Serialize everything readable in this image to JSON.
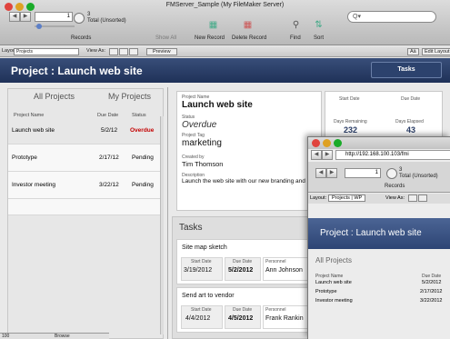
{
  "window": {
    "title": "FMServer_Sample (My FileMaker Server)"
  },
  "toolbar": {
    "record_number": "1",
    "record_count": "3",
    "found_status": "Total (Unsorted)",
    "records_label": "Records",
    "show_all": "Show All",
    "new_record": "New Record",
    "delete_record": "Delete Record",
    "find": "Find",
    "sort": "Sort",
    "search_placeholder": "Q▾"
  },
  "layout_bar": {
    "layout_label": "Layout:",
    "layout_value": "Projects",
    "view_as": "View As:",
    "preview": "Preview",
    "font_btn": "Aä",
    "edit_layout": "Edit Layout"
  },
  "header": {
    "title": "Project : Launch web site",
    "tasks_btn": "Tasks"
  },
  "left": {
    "tab_all": "All Projects",
    "tab_my": "My Projects",
    "col_name": "Project Name",
    "col_due": "Due Date",
    "col_status": "Status",
    "rows": [
      {
        "name": "Launch web site",
        "due": "5/2/12",
        "status": "Overdue"
      },
      {
        "name": "Prototype",
        "due": "2/17/12",
        "status": "Pending"
      },
      {
        "name": "Investor meeting",
        "due": "3/22/12",
        "status": "Pending"
      }
    ]
  },
  "detail": {
    "name_lbl": "Project Name",
    "name": "Launch web site",
    "status_lbl": "Status",
    "status": "Overdue",
    "tag_lbl": "Project Tag",
    "tag": "marketing",
    "created_lbl": "Created by",
    "created": "Tim Thomson",
    "desc_lbl": "Description",
    "desc": "Launch the web site with our new branding and",
    "start_lbl": "Start Date",
    "due_lbl": "Due Date",
    "remain_lbl": "Days Remaining",
    "remain": "232",
    "elapsed_lbl": "Days Elapsed",
    "elapsed": "43"
  },
  "tasks": {
    "title": "Tasks",
    "start_lbl": "Start Date",
    "due_lbl": "Due Date",
    "person_lbl": "Personnel",
    "items": [
      {
        "name": "Site map sketch",
        "start": "3/19/2012",
        "due": "5/2/2012",
        "person": "Ann Johnson"
      },
      {
        "name": "Send art to vendor",
        "start": "4/4/2012",
        "due": "4/5/2012",
        "person": "Frank Rankin"
      }
    ]
  },
  "status_bar": {
    "zoom": "100",
    "mode": "Browse"
  },
  "browser": {
    "url": "http://192.168.100.103/fmi",
    "record_number": "1",
    "record_count": "3",
    "found_status": "Total (Unsorted)",
    "records_label": "Records",
    "layout_label": "Layout:",
    "layout_value": "Projects | WP",
    "view_as": "View As:",
    "header_title": "Project : Launch web site",
    "tab_all": "All Projects",
    "col_name": "Project Name",
    "col_due": "Due Date",
    "rows": [
      {
        "name": "Launch web site",
        "due": "5/2/2012"
      },
      {
        "name": "Prototype",
        "due": "2/17/2012"
      },
      {
        "name": "Investor meeting",
        "due": "3/22/2012"
      }
    ]
  },
  "colors": {
    "header": "#2a3d66",
    "overdue": "#c40000",
    "selection": "#e7e7e7"
  }
}
